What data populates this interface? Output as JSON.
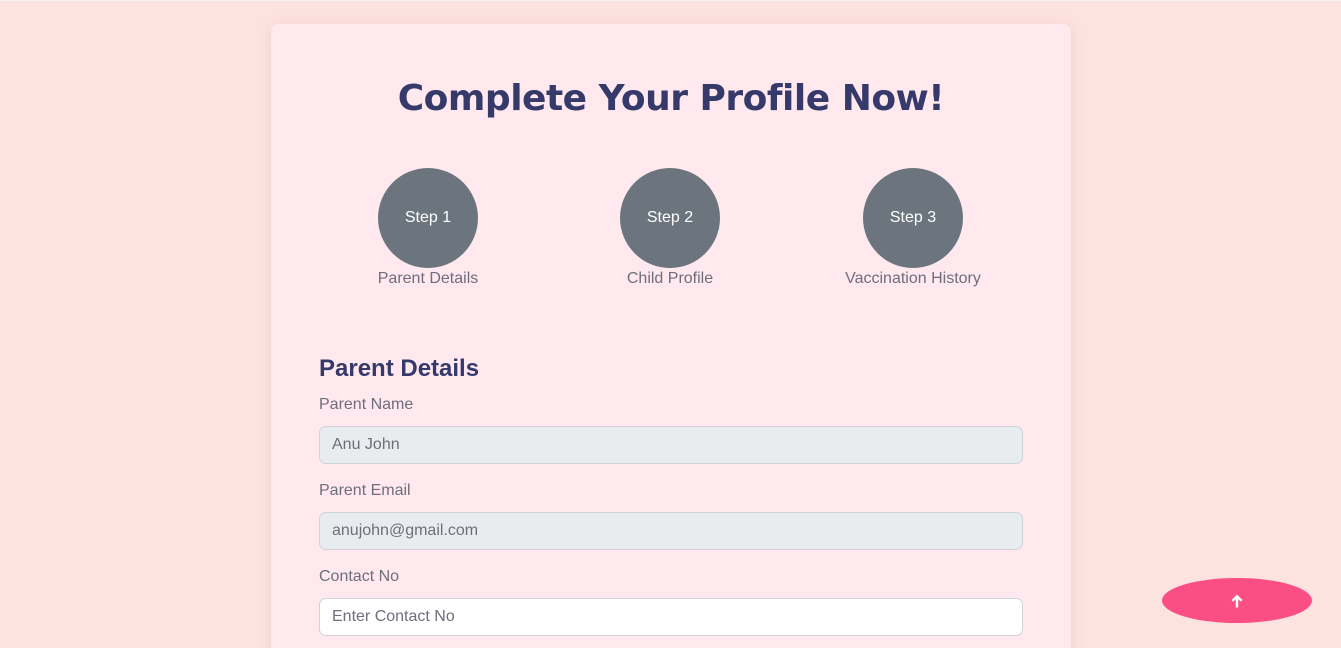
{
  "form": {
    "title": "Complete Your Profile Now!",
    "steps": [
      {
        "circle_label": "Step 1",
        "caption": "Parent Details"
      },
      {
        "circle_label": "Step 2",
        "caption": "Child Profile"
      },
      {
        "circle_label": "Step 3",
        "caption": "Vaccination History"
      }
    ],
    "section_title": "Parent Details",
    "fields": {
      "parent_name": {
        "label": "Parent Name",
        "value": "Anu John"
      },
      "parent_email": {
        "label": "Parent Email",
        "value": "anujohn@gmail.com"
      },
      "contact_no": {
        "label": "Contact No",
        "value": "",
        "placeholder": "Enter Contact No"
      }
    }
  },
  "scroll_top_button": {
    "icon": "arrow-up-icon"
  },
  "colors": {
    "page_background": "#fde3e0",
    "card_background": "#ffe9ee",
    "heading": "#363a6b",
    "step_circle": "#6c757d",
    "readonly_input": "#e9ecef",
    "accent_button": "#fb4e85"
  }
}
